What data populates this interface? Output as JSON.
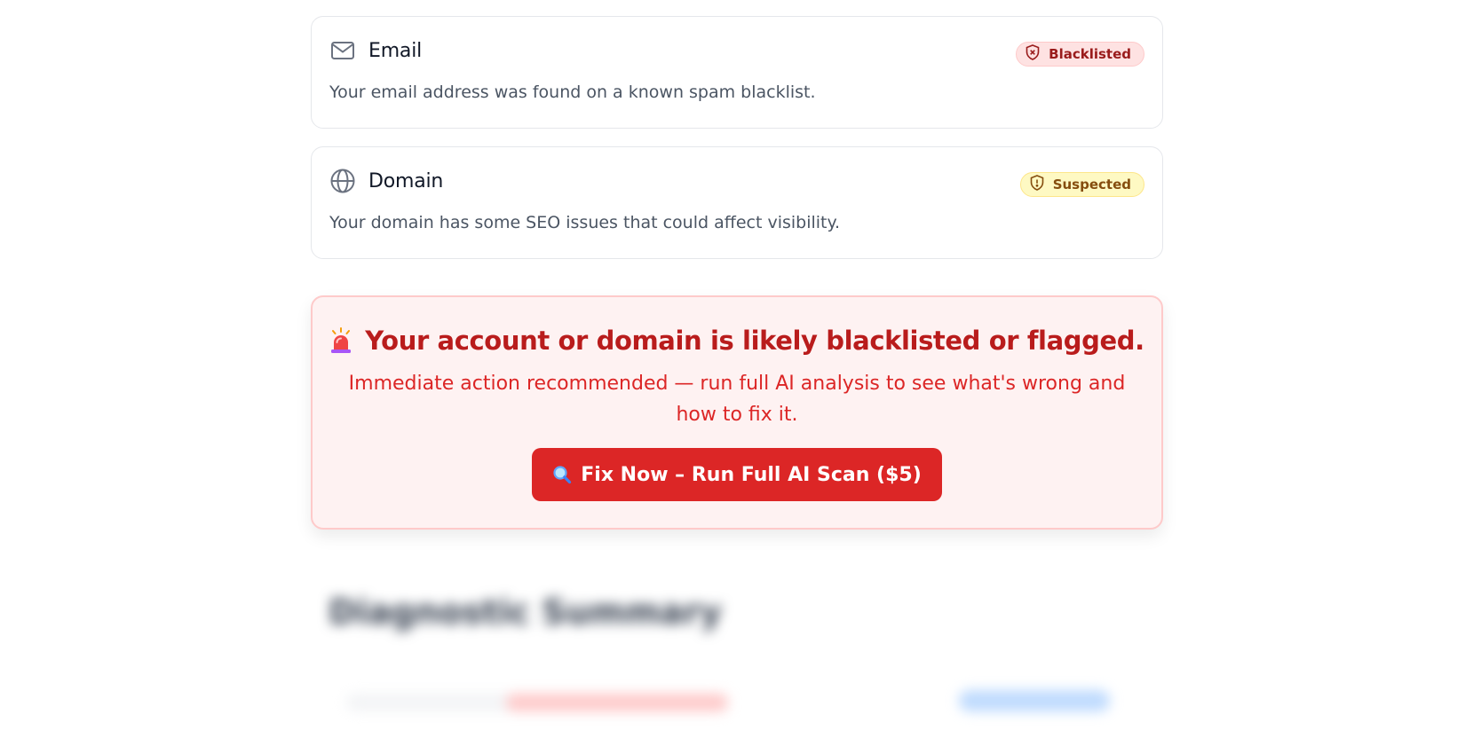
{
  "checks": [
    {
      "icon": "mail-icon",
      "title": "Email",
      "status": "Blacklisted",
      "status_icon": "shield-x-icon",
      "status_color": "#991b1b",
      "description": "Your email address was found on a known spam blacklist."
    },
    {
      "icon": "globe-icon",
      "title": "Domain",
      "status": "Suspected",
      "status_icon": "shield-alert-icon",
      "status_color": "#854d0e",
      "description": "Your domain has some SEO issues that could affect visibility."
    }
  ],
  "alert": {
    "icon": "siren-icon",
    "title": "Your account or domain is likely blacklisted or flagged.",
    "subtitle": "Immediate action recommended — run full AI analysis to see what's wrong and how to fix it.",
    "button_icon": "magnifier-icon",
    "button_label": "Fix Now – Run Full AI Scan ($5)",
    "accent": "#dc2626"
  },
  "blurred_section": {
    "title": "Diagnostic Summary"
  }
}
